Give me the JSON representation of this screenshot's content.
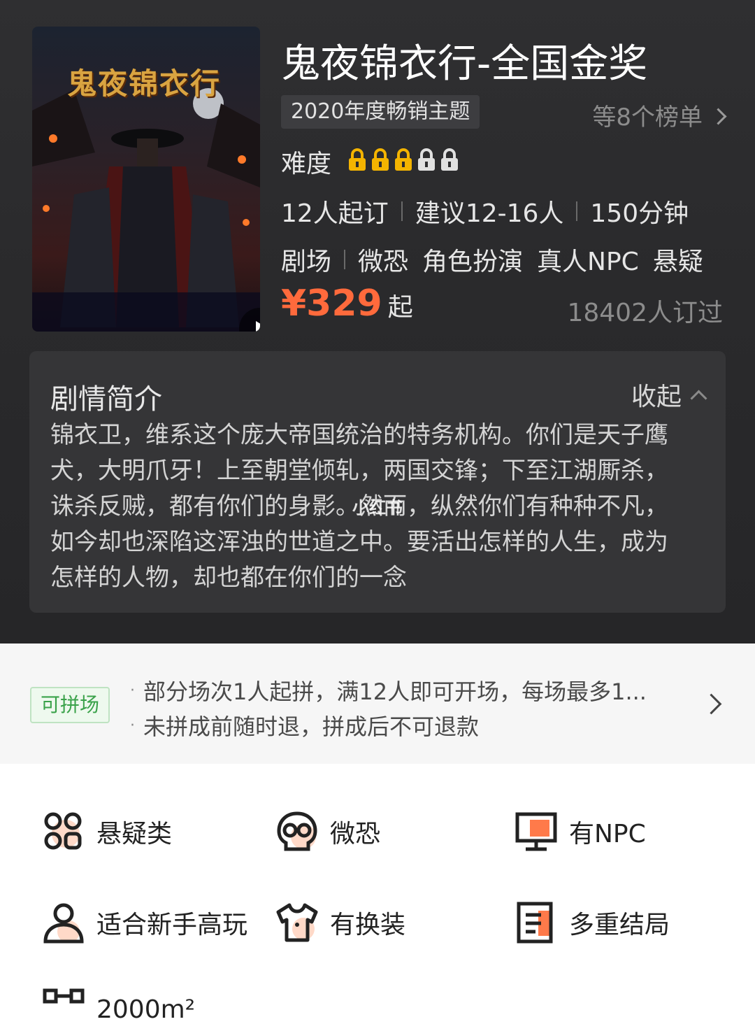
{
  "poster": {
    "title": "鬼夜锦衣行",
    "play_icon": "play-icon"
  },
  "title": "鬼夜锦衣行-全国金奖",
  "rank": {
    "tag": "2020年度畅销主题",
    "more": "等8个榜单"
  },
  "difficulty": {
    "label": "难度",
    "locks_filled": 3,
    "locks_total": 5,
    "filled_color": "#f4b400",
    "empty_color": "#e0e0e0"
  },
  "meta": {
    "min_people": "12人起订",
    "suggested": "建议12-16人",
    "duration": "150分钟"
  },
  "tags": {
    "category": "剧场",
    "items": [
      "微恐",
      "角色扮演",
      "真人NPC",
      "悬疑"
    ]
  },
  "price": {
    "amount": "¥329",
    "suffix": "起",
    "booked": "18402人订过",
    "accent": "#ff6a3c"
  },
  "synopsis": {
    "heading": "剧情简介",
    "collapse": "收起",
    "lines": [
      "锦衣卫，维系这个庞大帝国统治的特务机构。你们是天子鹰",
      "犬，大明爪牙！上至朝堂倾轧，两国交锋；下至江湖厮杀，",
      "诛杀反贼，都有你们的身影。然而，纵然你们有种种不凡，",
      "如今却也深陷这浑浊的世道之中。要活出怎样的人生，成为",
      "怎样的人物，却也都在你们的一念"
    ],
    "watermark": "小红书"
  },
  "pin": {
    "tag": "可拼场",
    "line1": "部分场次1人起拼，满12人即可开场，每场最多1...",
    "line2": "未拼成前随时退，拼成后不可退款"
  },
  "features": [
    {
      "icon": "grid-icon",
      "label": "悬疑类"
    },
    {
      "icon": "skull-icon",
      "label": "微恐"
    },
    {
      "icon": "monitor-icon",
      "label": "有NPC"
    },
    {
      "icon": "user-icon",
      "label": "适合新手高玩"
    },
    {
      "icon": "shirt-icon",
      "label": "有换装"
    },
    {
      "icon": "document-icon",
      "label": "多重结局"
    },
    {
      "icon": "network-icon",
      "label": "2000m²"
    }
  ]
}
